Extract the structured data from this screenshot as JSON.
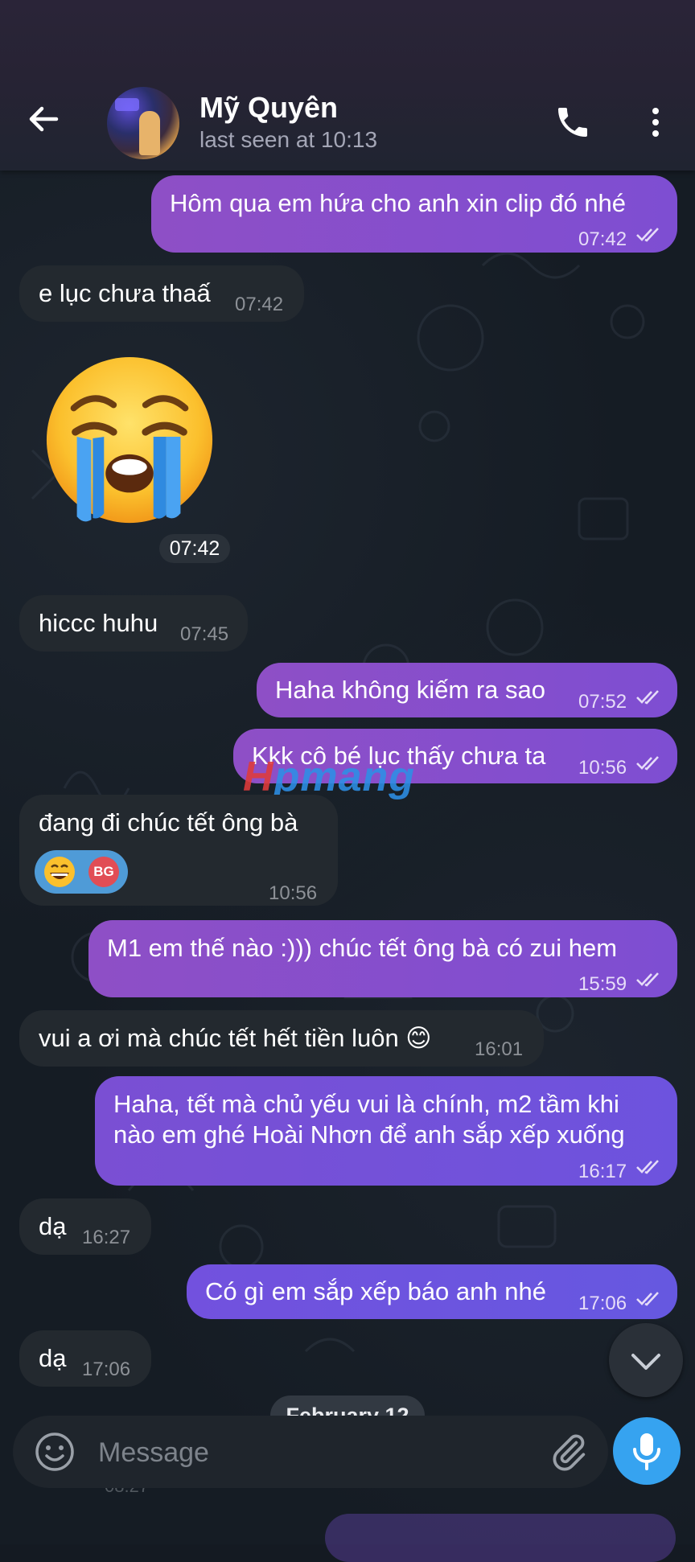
{
  "header": {
    "contact_name": "Mỹ Quyên",
    "status": "last seen at 10:13"
  },
  "messages": [
    {
      "dir": "out",
      "text": "Hôm qua em hứa cho anh xin clip đó nhé",
      "time": "07:42",
      "read": true
    },
    {
      "dir": "in",
      "text": "e lục chưa thaấ",
      "time": "07:42"
    },
    {
      "dir": "in",
      "type": "sticker",
      "emoji": "loudly-crying-face",
      "time": "07:42"
    },
    {
      "dir": "in",
      "text": "hiccc huhu",
      "time": "07:45"
    },
    {
      "dir": "out",
      "text": "Haha không kiếm ra sao",
      "time": "07:52",
      "read": true
    },
    {
      "dir": "out",
      "text": "Kkk cô bé lục thấy chưa ta",
      "time": "10:56",
      "read": true
    },
    {
      "dir": "in",
      "text": "đang đi chúc tết ông bà",
      "time": "10:56",
      "reaction": {
        "emoji": "grinning-face",
        "avatar_initials": "BG"
      }
    },
    {
      "dir": "out",
      "text": "M1 em thế nào :))) chúc tết ông bà có zui hem",
      "time": "15:59",
      "read": true
    },
    {
      "dir": "in",
      "text": "vui a ơi mà chúc tết hết tiền luôn 😊",
      "time": "16:01"
    },
    {
      "dir": "out",
      "lines": [
        "Haha, tết mà chủ yếu vui là chính, m2 tầm khi",
        "nào em ghé Hoài Nhơn để anh sắp xếp xuống"
      ],
      "time": "16:17",
      "read": true
    },
    {
      "dir": "in",
      "text": "dạ",
      "time": "16:27"
    },
    {
      "dir": "out",
      "text": "Có gì em sắp xếp báo anh nhé",
      "time": "17:06",
      "read": true
    },
    {
      "dir": "in",
      "text": "dạ",
      "time": "17:06"
    }
  ],
  "date_separator": "February 12",
  "watermark": "Hpmang",
  "input": {
    "placeholder": "Message"
  },
  "icons": {
    "back": "arrow-left-icon",
    "call": "phone-icon",
    "more": "more-vertical-icon",
    "emoji": "smile-icon",
    "attach": "paperclip-icon",
    "mic": "microphone-icon",
    "scroll": "chevron-down-icon"
  },
  "colors": {
    "header_bg": "#272334",
    "incoming_bubble": "#23292f",
    "outgoing_bubble": "#8e4fc6",
    "mic_button": "#36a3f0",
    "reaction_bg": "#4f9bd7"
  }
}
